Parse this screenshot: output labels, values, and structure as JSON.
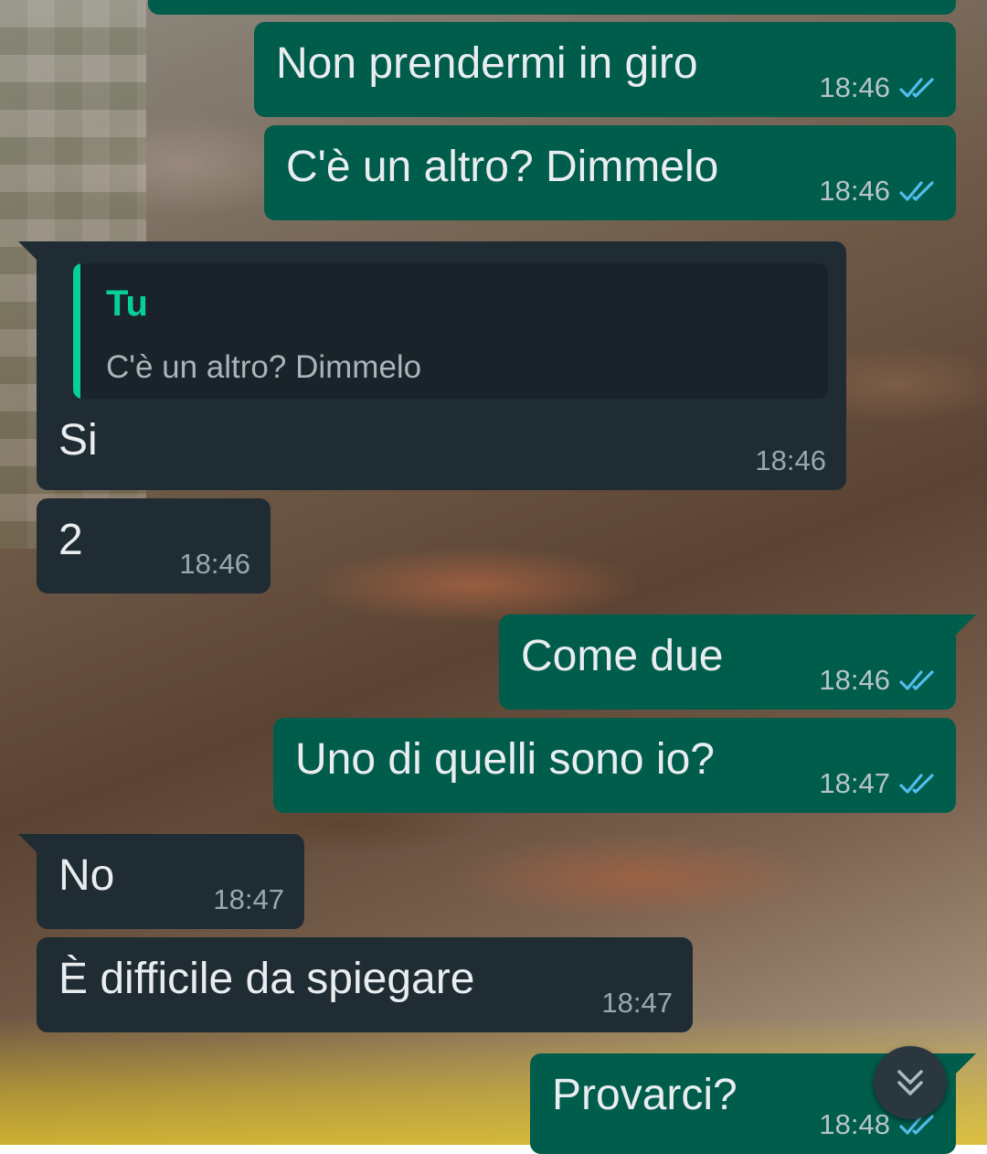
{
  "chat": {
    "messages": [
      {
        "direction": "out",
        "text": "Non prendermi in giro",
        "time": "18:46",
        "status": "read"
      },
      {
        "direction": "out",
        "text": "C'è un altro? Dimmelo",
        "time": "18:46",
        "status": "read"
      },
      {
        "direction": "in",
        "text": "Si",
        "time": "18:46",
        "quote": {
          "author": "Tu",
          "text": "C'è un altro? Dimmelo"
        }
      },
      {
        "direction": "in",
        "text": "2",
        "time": "18:46"
      },
      {
        "direction": "out",
        "text": "Come due",
        "time": "18:46",
        "status": "read"
      },
      {
        "direction": "out",
        "text": "Uno di quelli sono io?",
        "time": "18:47",
        "status": "read"
      },
      {
        "direction": "in",
        "text": "No",
        "time": "18:47"
      },
      {
        "direction": "in",
        "text": "È difficile da spiegare",
        "time": "18:47"
      },
      {
        "direction": "out",
        "text": "Provarci?",
        "time": "18:48",
        "status": "read"
      }
    ]
  },
  "icons": {
    "read_receipt": "double-check-icon",
    "scroll_down": "chevron-double-down-icon"
  },
  "colors": {
    "outgoing_bubble": "#005c4b",
    "incoming_bubble": "#202c33",
    "read_tick": "#53bdeb",
    "quote_accent": "#06cf9c"
  }
}
